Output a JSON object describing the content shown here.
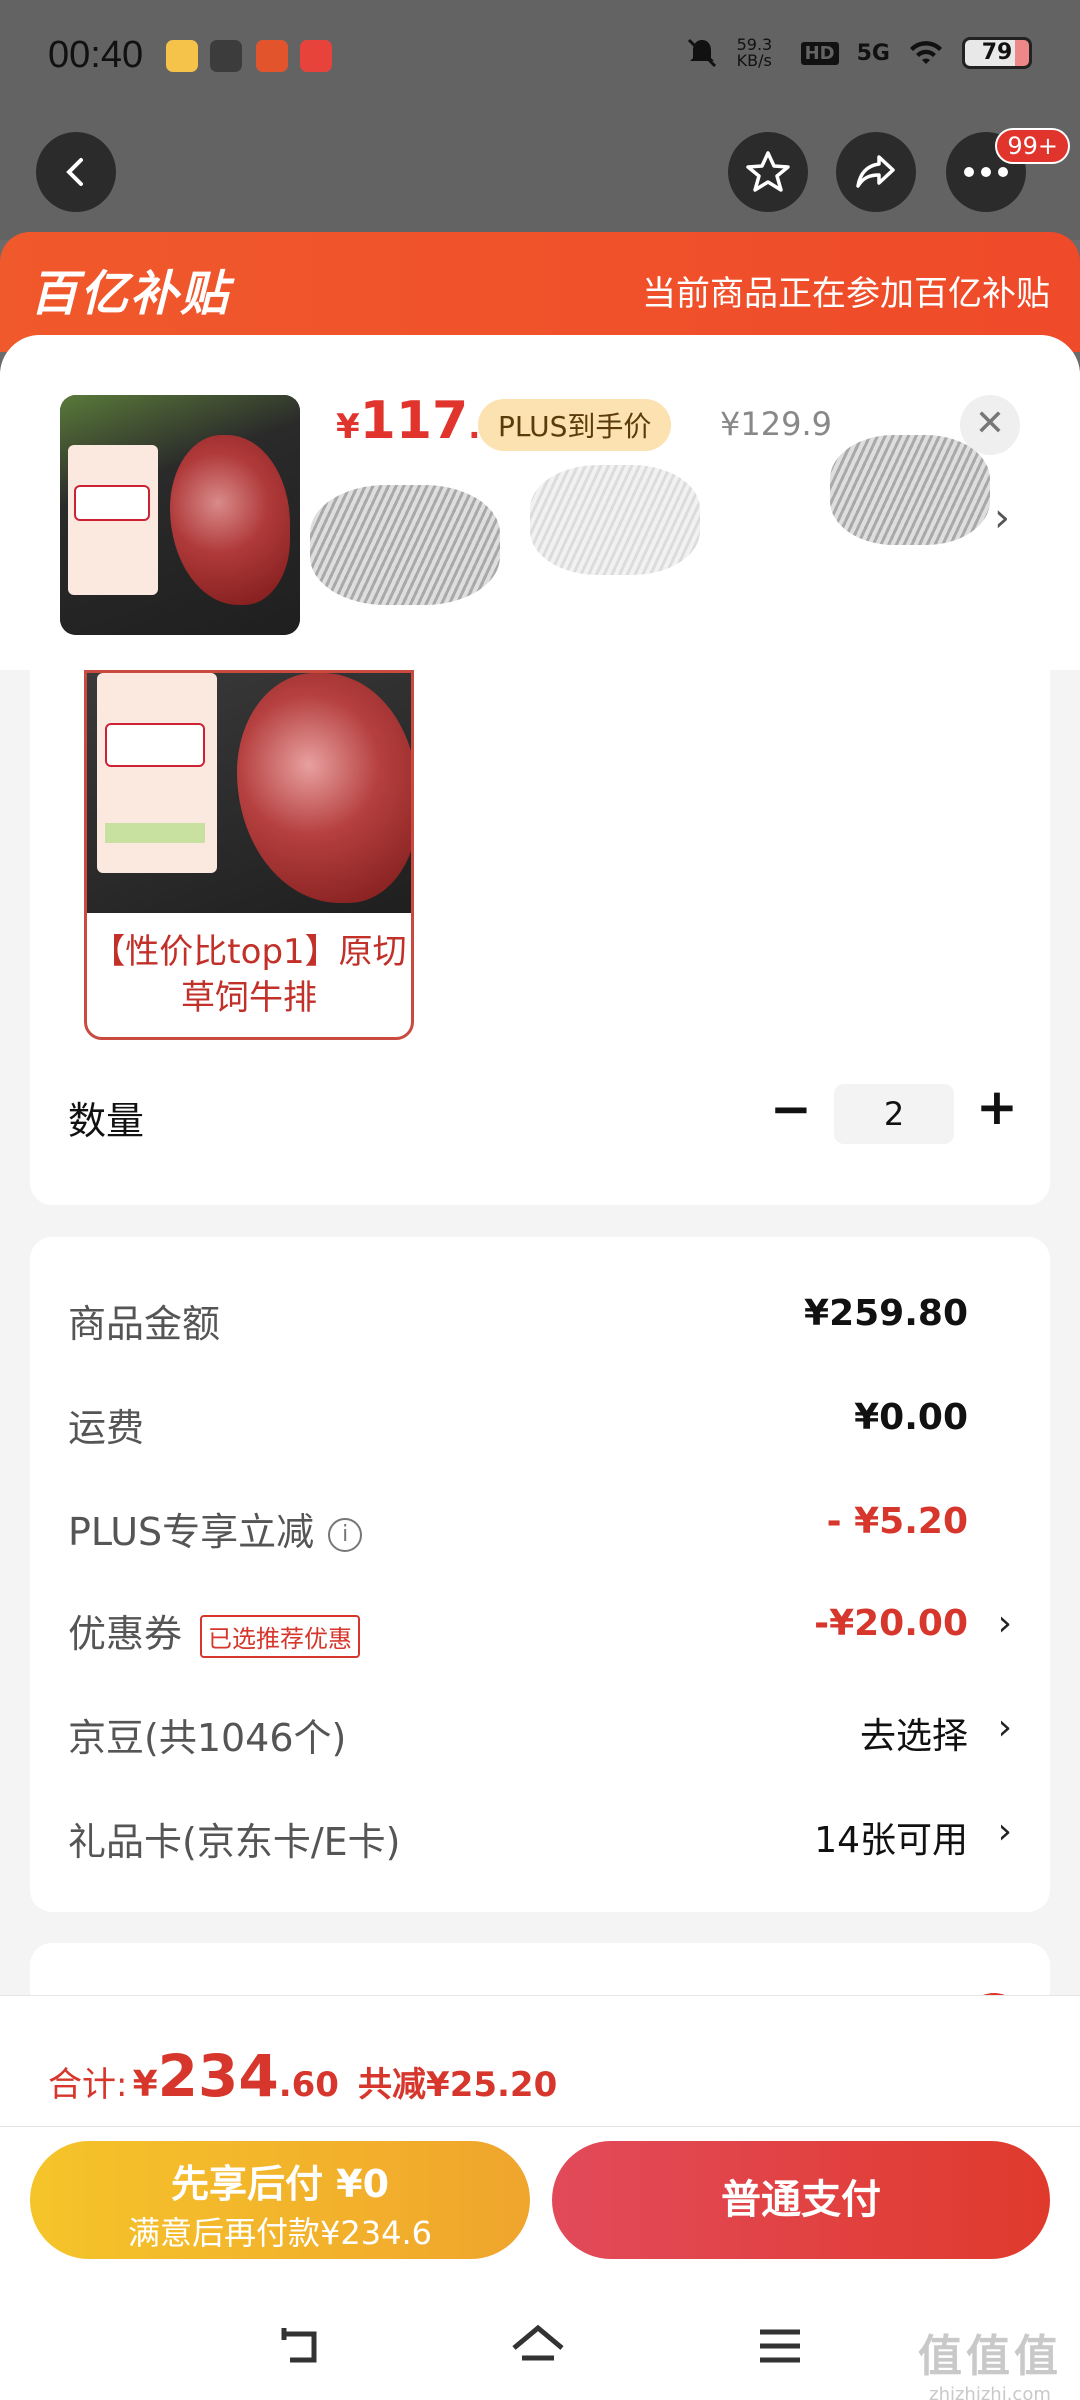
{
  "status_bar": {
    "time": "00:40",
    "net_speed": "59.3\nKB/s",
    "hd": "HD",
    "signal": "5G",
    "battery": "79"
  },
  "nav": {
    "more_badge": "99+"
  },
  "banner": {
    "logo": "百亿补贴",
    "tagline": "当前商品正在参加百亿补贴"
  },
  "product": {
    "price_yen": "¥",
    "price_int": "117",
    "price_dec": ".3",
    "plus_tag": "PLUS到手价",
    "original_price": "¥129.9"
  },
  "spec": {
    "option_label": "【性价比top1】原切草饲牛排"
  },
  "quantity": {
    "label": "数量",
    "value": "2",
    "minus": "−",
    "plus": "+"
  },
  "fees": {
    "goods_amount": {
      "label": "商品金额",
      "value": "¥259.80"
    },
    "shipping": {
      "label": "运费",
      "value": "¥0.00"
    },
    "plus_discount": {
      "label": "PLUS专享立减",
      "value": "- ¥5.20"
    },
    "coupon": {
      "label": "优惠券",
      "tag": "已选推荐优惠",
      "value": "-¥20.00"
    },
    "jingdou": {
      "label": "京豆(共1046个)",
      "value": "去选择"
    },
    "gift_card": {
      "label": "礼品卡(京东卡/E卡)",
      "value": "14张可用"
    }
  },
  "bottom": {
    "total_label": "合计:",
    "total_yen": "¥",
    "total_int": "234",
    "total_dec": ".60",
    "total_saved": "共减¥25.20",
    "btn_later_line1": "先享后付 ¥0",
    "btn_later_line2": "满意后再付款¥234.6",
    "btn_pay": "普通支付"
  },
  "watermark": {
    "line1": "值值值",
    "line2": "zhizhizhi.com"
  },
  "colors": {
    "brand_orange": "#f0592b",
    "price_red": "#d6362b",
    "plus_gold": "#fbe2b0",
    "pay_red": "#e03a2c",
    "later_yellow": "#f5c42a"
  }
}
